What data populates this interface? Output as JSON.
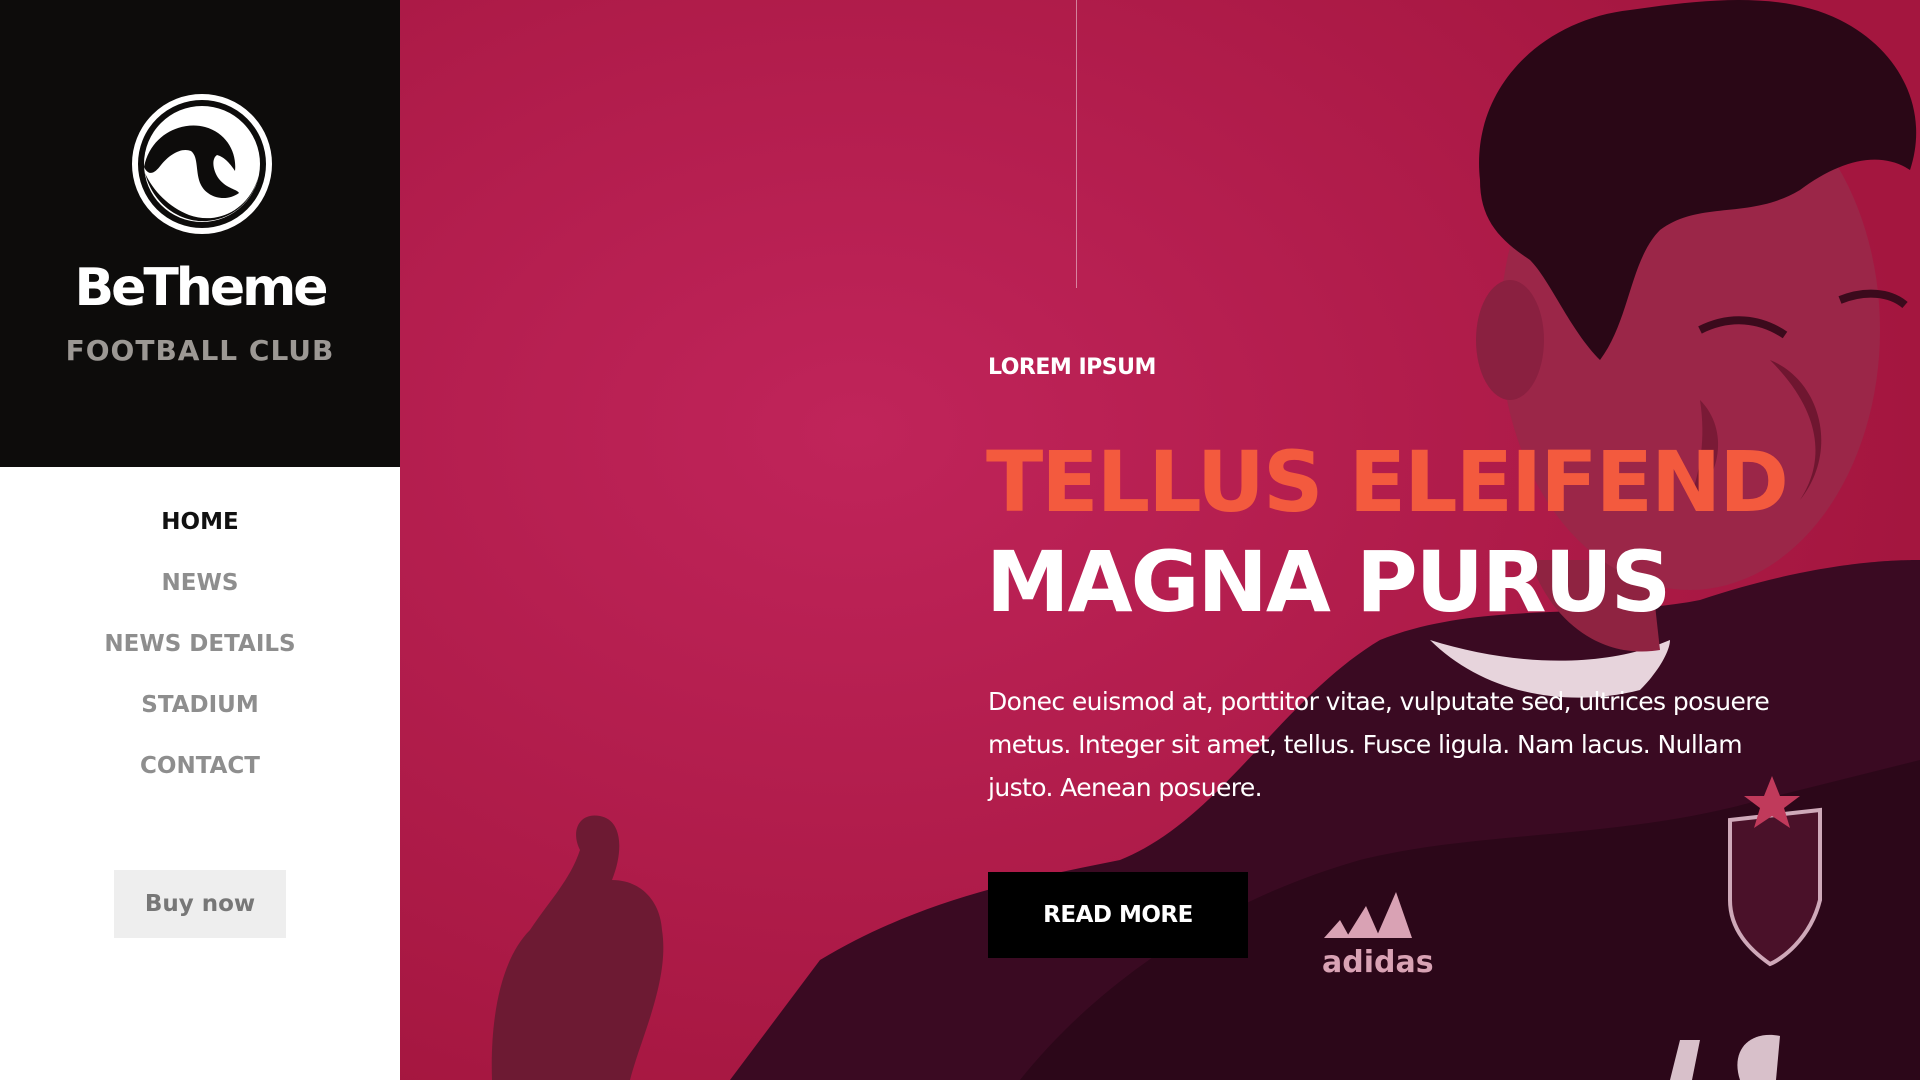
{
  "brand": {
    "name": "BeTheme",
    "subtitle": "FOOTBALL CLUB",
    "logo_icon": "swan-logo-icon"
  },
  "nav": {
    "items": [
      {
        "label": "HOME",
        "active": true
      },
      {
        "label": "NEWS",
        "active": false
      },
      {
        "label": "NEWS DETAILS",
        "active": false
      },
      {
        "label": "STADIUM",
        "active": false
      },
      {
        "label": "CONTACT",
        "active": false
      }
    ],
    "buy_label": "Buy now"
  },
  "hero": {
    "eyebrow": "LOREM IPSUM",
    "title_line1": "TELLUS ELEIFEND",
    "title_line2": "MAGNA PURUS",
    "description": "Donec euismod at, porttitor vitae, vulputate sed, ultrices posuere metus. Integer sit amet, tellus. Fusce ligula. Nam lacus. Nullam justo. Aenean posuere.",
    "button_label": "READ MORE",
    "jersey_brand": "adidas"
  },
  "colors": {
    "sidebar_dark": "#0d0c0b",
    "hero_background": "#b21a4b",
    "accent": "#f35a3e",
    "nav_active": "#111111",
    "nav_inactive": "#8e8e8e"
  }
}
